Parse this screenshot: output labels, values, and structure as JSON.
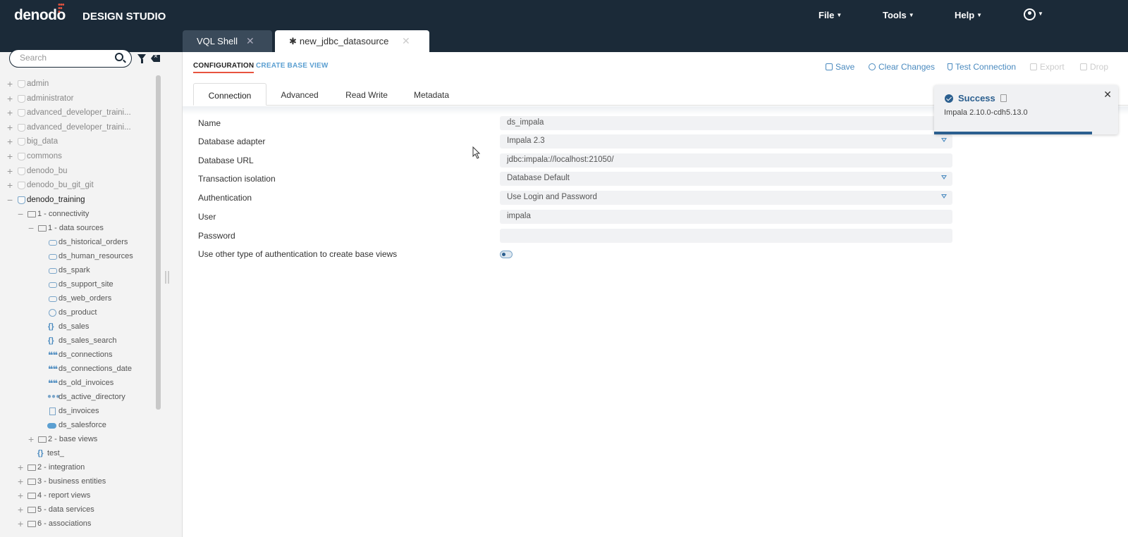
{
  "header": {
    "logo": "denodo",
    "product": "DESIGN STUDIO",
    "menus": [
      "File",
      "Tools",
      "Help"
    ]
  },
  "doc_tabs": [
    {
      "label": "VQL Shell",
      "modified": false
    },
    {
      "label": "new_jdbc_datasource",
      "modified": true
    }
  ],
  "sidebar": {
    "search_placeholder": "Search",
    "databases": [
      "admin",
      "administrator",
      "advanced_developer_traini...",
      "advanced_developer_traini...",
      "big_data",
      "commons",
      "denodo_bu",
      "denodo_bu_git_git"
    ],
    "open_database": "denodo_training",
    "folder_connectivity": "1 - connectivity",
    "folder_data_sources": "1 - data sources",
    "data_sources": [
      {
        "label": "ds_historical_orders",
        "icon": "database-source-icon"
      },
      {
        "label": "ds_human_resources",
        "icon": "database-source-icon"
      },
      {
        "label": "ds_spark",
        "icon": "database-source-icon"
      },
      {
        "label": "ds_support_site",
        "icon": "database-source-icon"
      },
      {
        "label": "ds_web_orders",
        "icon": "database-source-icon"
      },
      {
        "label": "ds_product",
        "icon": "web-service-icon"
      },
      {
        "label": "ds_sales",
        "icon": "json-icon"
      },
      {
        "label": "ds_sales_search",
        "icon": "json-icon"
      },
      {
        "label": "ds_connections",
        "icon": "delimited-file-icon"
      },
      {
        "label": "ds_connections_date",
        "icon": "delimited-file-icon"
      },
      {
        "label": "ds_old_invoices",
        "icon": "delimited-file-icon"
      },
      {
        "label": "ds_active_directory",
        "icon": "ldap-icon"
      },
      {
        "label": "ds_invoices",
        "icon": "excel-icon"
      },
      {
        "label": "ds_salesforce",
        "icon": "salesforce-icon"
      }
    ],
    "folder_base_views": "2 - base views",
    "test_item": "test_",
    "top_folders": [
      "2 - integration",
      "3 - business entities",
      "4 - report views",
      "5 - data services",
      "6 - associations"
    ]
  },
  "main": {
    "subtabs": {
      "configuration": "CONFIGURATION",
      "create_base_view": "CREATE BASE VIEW"
    },
    "toolbar": {
      "save": "Save",
      "clear": "Clear Changes",
      "test": "Test Connection",
      "export": "Export",
      "drop": "Drop"
    },
    "config_tabs": [
      "Connection",
      "Advanced",
      "Read Write",
      "Metadata"
    ],
    "form": {
      "name_label": "Name",
      "name_value": "ds_impala",
      "adapter_label": "Database adapter",
      "adapter_value": "Impala 2.3",
      "url_label": "Database URL",
      "url_value": "jdbc:impala://localhost:21050/",
      "isolation_label": "Transaction isolation",
      "isolation_value": "Database Default",
      "auth_label": "Authentication",
      "auth_value": "Use Login and Password",
      "user_label": "User",
      "user_value": "impala",
      "password_label": "Password",
      "password_value": "",
      "other_auth_label": "Use other type of authentication to create base views"
    }
  },
  "notification": {
    "title": "Success",
    "message": "Impala 2.10.0-cdh5.13.0",
    "progress": 0.86
  },
  "colors": {
    "topbar": "#1b2a38",
    "accent": "#e8533f",
    "link": "#4a8abf",
    "success": "#2b5f8f"
  }
}
